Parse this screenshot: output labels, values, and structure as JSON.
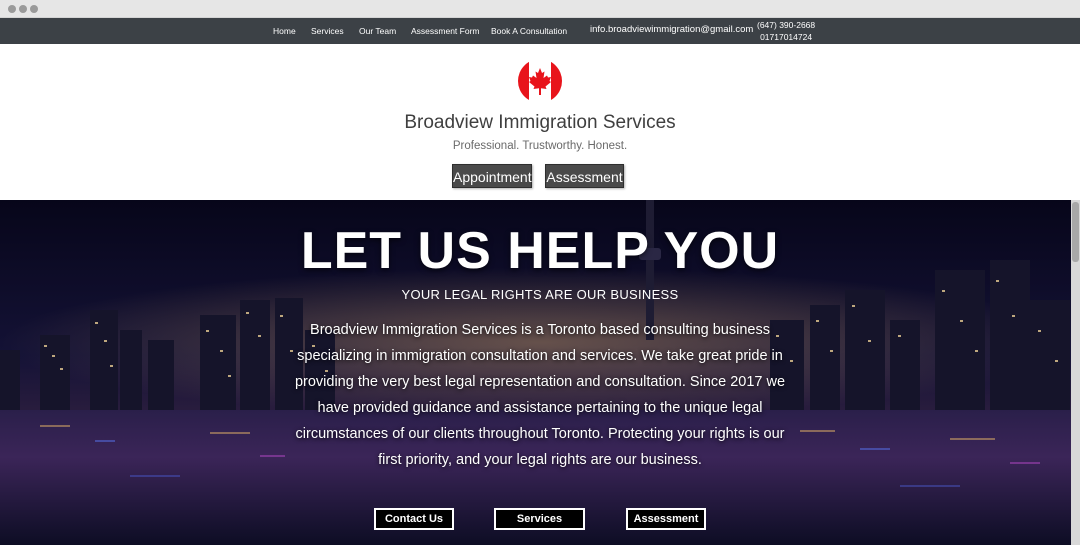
{
  "nav": {
    "items": [
      {
        "label": "Home"
      },
      {
        "label": "Services"
      },
      {
        "label": "Our Team"
      },
      {
        "label": "Assessment Form"
      },
      {
        "label": "Book A Consultation"
      }
    ],
    "email": "info.broadviewimmigration@gmail.com",
    "phone_line1": "(647) 390-2668",
    "phone_line2": "01717014724"
  },
  "header": {
    "logo_icon": "canada-flag-icon",
    "title": "Broadview Immigration Services",
    "tagline": "Professional. Trustworthy. Honest.",
    "appointment_label": "Appointment",
    "assessment_label": "Assessment"
  },
  "hero": {
    "title": "LET US HELP YOU",
    "subtitle": "YOUR LEGAL RIGHTS ARE OUR BUSINESS",
    "body": "Broadview Immigration Services is a Toronto based consulting business specializing in immigration consultation and services. We take great pride in providing the very best legal representation and consultation. Since 2017 we have provided guidance and assistance pertaining to the unique legal circumstances of our clients throughout Toronto. Protecting your rights is our first priority, and your legal rights are our business.",
    "buttons": {
      "contact": "Contact Us",
      "services": "Services",
      "assessment": "Assessment"
    }
  },
  "colors": {
    "navbar": "#3c4146",
    "flag_red": "#e8141b",
    "button_dark": "#4a4a4a"
  }
}
